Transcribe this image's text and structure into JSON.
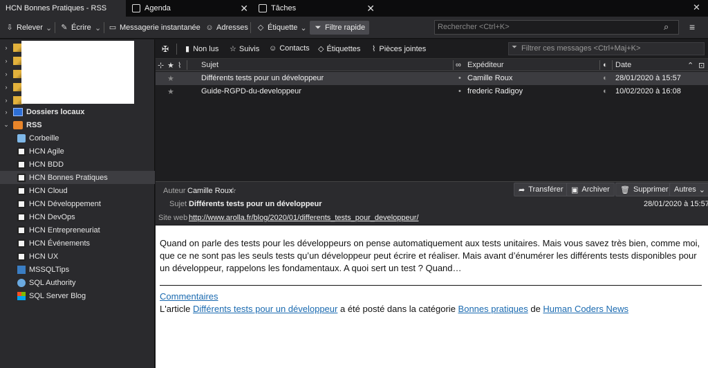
{
  "tabs": [
    {
      "label": "HCN Bonnes Pratiques - RSS",
      "active": true
    },
    {
      "label": "Agenda",
      "active": false
    },
    {
      "label": "Tâches",
      "active": false
    }
  ],
  "toolbar": {
    "relever": "Relever",
    "ecrire": "Écrire",
    "messagerie": "Messagerie instantanée",
    "adresses": "Adresses",
    "etiquette": "Étiquette",
    "filtre_rapide": "Filtre rapide",
    "search_placeholder": "Rechercher <Ctrl+K>"
  },
  "sidebar": {
    "accounts_count": 5,
    "dossiers_locaux": "Dossiers locaux",
    "rss": "RSS",
    "feeds": [
      {
        "label": "Corbeille",
        "icon": "trash-icon"
      },
      {
        "label": "HCN Agile",
        "icon": "hcn-feed-icon"
      },
      {
        "label": "HCN BDD",
        "icon": "hcn-feed-icon"
      },
      {
        "label": "HCN Bonnes Pratiques",
        "icon": "hcn-feed-icon",
        "selected": true
      },
      {
        "label": "HCN Cloud",
        "icon": "hcn-feed-icon"
      },
      {
        "label": "HCN Développement",
        "icon": "hcn-feed-icon"
      },
      {
        "label": "HCN DevOps",
        "icon": "hcn-feed-icon"
      },
      {
        "label": "HCN Entrepreneuriat",
        "icon": "hcn-feed-icon"
      },
      {
        "label": "HCN Événements",
        "icon": "hcn-feed-icon"
      },
      {
        "label": "HCN UX",
        "icon": "hcn-feed-icon"
      },
      {
        "label": "MSSQLTips",
        "icon": "mssqltips-icon"
      },
      {
        "label": "SQL Authority",
        "icon": "sqlauthority-icon"
      },
      {
        "label": "SQL Server Blog",
        "icon": "windows-logo-icon"
      }
    ]
  },
  "filterbar": {
    "non_lus": "Non lus",
    "suivis": "Suivis",
    "contacts": "Contacts",
    "etiquettes": "Étiquettes",
    "pieces_jointes": "Pièces jointes",
    "filter_placeholder": "Filtrer ces messages <Ctrl+Maj+K>"
  },
  "columns": {
    "sujet": "Sujet",
    "expediteur": "Expéditeur",
    "date": "Date"
  },
  "messages": [
    {
      "subject": "Différents tests pour un développeur",
      "sender": "Camille Roux",
      "date": "28/01/2020 à 15:57",
      "selected": true
    },
    {
      "subject": "Guide-RGPD-du-developpeur",
      "sender": "frederic Radigoy",
      "date": "10/02/2020 à 16:08",
      "selected": false
    }
  ],
  "header": {
    "auteur_label": "Auteur",
    "auteur": "Camille Roux",
    "sujet_label": "Sujet",
    "sujet": "Différents tests pour un développeur",
    "date": "28/01/2020 à 15:57",
    "siteweb_label": "Site web",
    "siteweb": "http://www.arolla.fr/blog/2020/01/differents_tests_pour_developpeur/",
    "transferer": "Transférer",
    "archiver": "Archiver",
    "supprimer": "Supprimer",
    "autres": "Autres"
  },
  "body": {
    "text": "Quand on parle des tests pour les développeurs on pense automatiquement aux tests unitaires. Mais vous savez très bien, comme moi, que ce ne sont pas les seuls tests qu’un développeur peut écrire et réaliser. Mais avant d’énumérer les différents tests disponibles pour un développeur, rappelons les fondamentaux. A quoi sert un test ? Quand…",
    "commentaires": "Commentaires",
    "article_prefix": "L'article ",
    "article_link": "Différents tests pour un développeur",
    "article_mid": " a été posté dans la catégorie ",
    "category_link": "Bonnes pratiques",
    "article_de": " de ",
    "source_link": "Human Coders News"
  }
}
